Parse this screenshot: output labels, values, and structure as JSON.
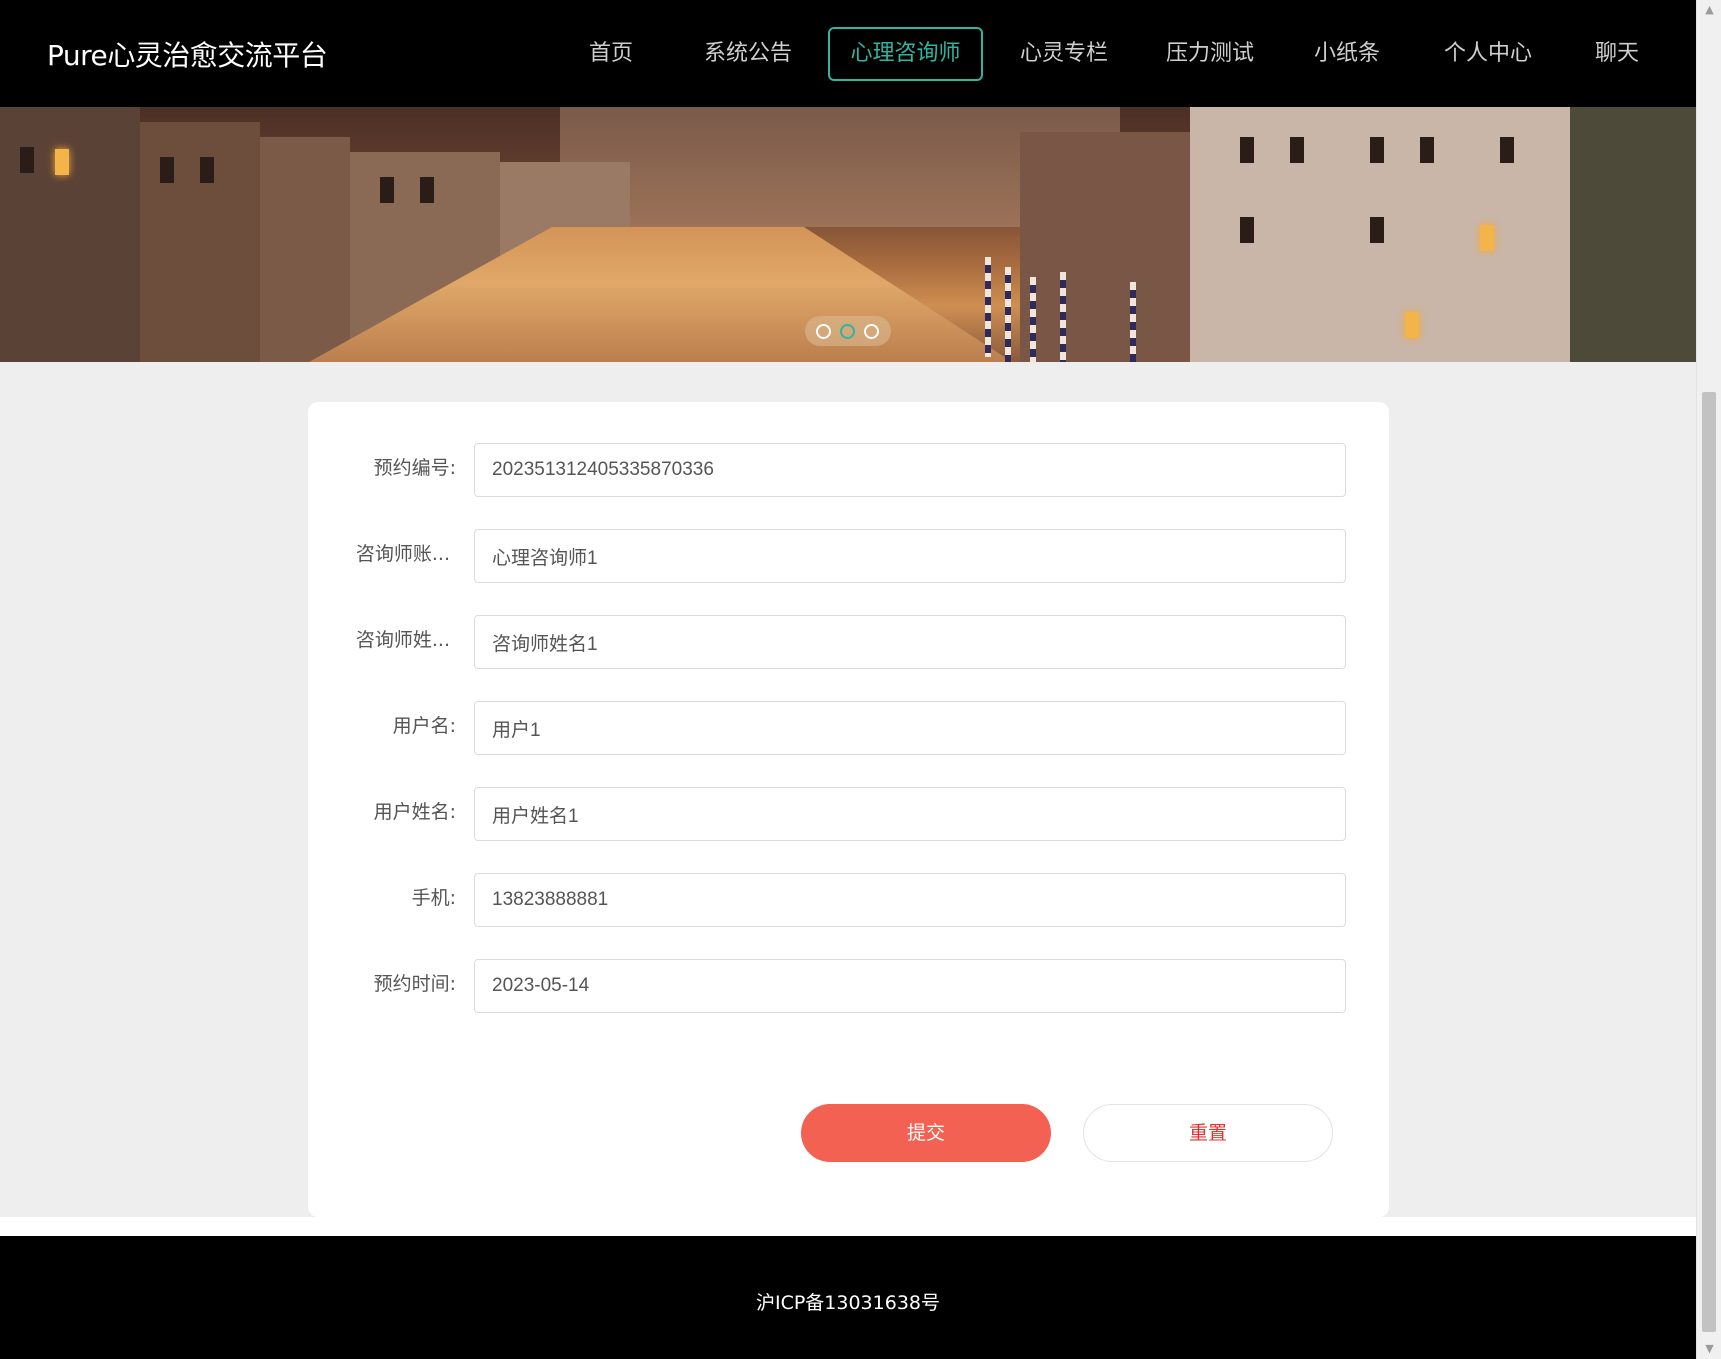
{
  "header": {
    "brand": "Pure心灵治愈交流平台",
    "nav": [
      {
        "label": "首页"
      },
      {
        "label": "系统公告"
      },
      {
        "label": "心理咨询师"
      },
      {
        "label": "心灵专栏"
      },
      {
        "label": "压力测试"
      },
      {
        "label": "小纸条"
      },
      {
        "label": "个人中心"
      },
      {
        "label": "聊天"
      }
    ],
    "active_nav": "心理咨询师",
    "accent_color": "#2fb5a0"
  },
  "banner": {
    "slides_count": 3,
    "active_slide": 2
  },
  "form": {
    "fields": [
      {
        "label": "预约编号:",
        "value": "20235131240533587 0336"
      },
      {
        "label": "咨询师账...",
        "value": "心理咨询师1"
      },
      {
        "label": "咨询师姓...",
        "value": "咨询师姓名1"
      },
      {
        "label": "用户名:",
        "value": "用户1"
      },
      {
        "label": "用户姓名:",
        "value": "用户姓名1"
      },
      {
        "label": "手机:",
        "value": "13823888881"
      },
      {
        "label": "预约时间:",
        "value": "2023-05-14"
      }
    ],
    "submit_label": "提交",
    "reset_label": "重置",
    "submit_color": "#f26152",
    "reset_text_color": "#e8312f"
  },
  "footer": {
    "text": "沪ICP备13031638号"
  },
  "icons": {
    "scroll_up": "scroll-up-arrow-icon",
    "scroll_down": "scroll-down-arrow-icon"
  }
}
